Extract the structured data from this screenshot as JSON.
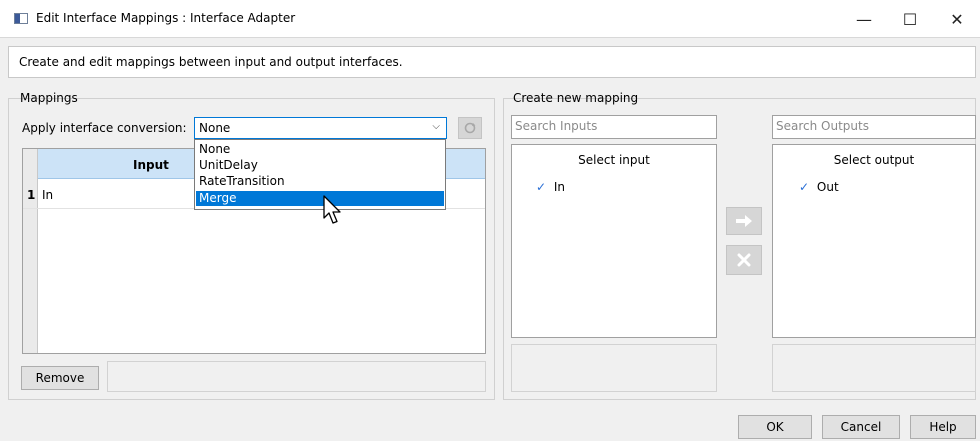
{
  "window": {
    "title": "Edit Interface Mappings : Interface Adapter",
    "minimize_glyph": "—",
    "maximize_glyph": "☐",
    "close_glyph": "✕"
  },
  "description": "Create and edit mappings between input and output interfaces.",
  "mappings": {
    "group_title": "Mappings",
    "conversion_label": "Apply interface conversion:",
    "conversion_value": "None",
    "conversion_options": [
      "None",
      "UnitDelay",
      "RateTransition",
      "Merge"
    ],
    "highlighted_option": "Merge",
    "table": {
      "column_header": "Input",
      "rows": [
        {
          "index": "1",
          "input": "In"
        }
      ]
    },
    "remove_label": "Remove"
  },
  "create_new_mapping": {
    "group_title": "Create new mapping",
    "search_inputs_placeholder": "Search Inputs",
    "search_outputs_placeholder": "Search Outputs",
    "select_input_header": "Select input",
    "select_output_header": "Select output",
    "inputs": [
      {
        "label": "In",
        "checked": true
      }
    ],
    "outputs": [
      {
        "label": "Out",
        "checked": true
      }
    ],
    "add_icon": "arrow-right-icon",
    "delete_icon": "x-icon"
  },
  "footer": {
    "ok_label": "OK",
    "cancel_label": "Cancel",
    "help_label": "Help"
  },
  "colors": {
    "selection": "#0078d7",
    "table_header": "#cce3f7",
    "check": "#2a6fd6"
  },
  "icons": {
    "check": "✓",
    "dropdown_arrow": "⌵"
  }
}
